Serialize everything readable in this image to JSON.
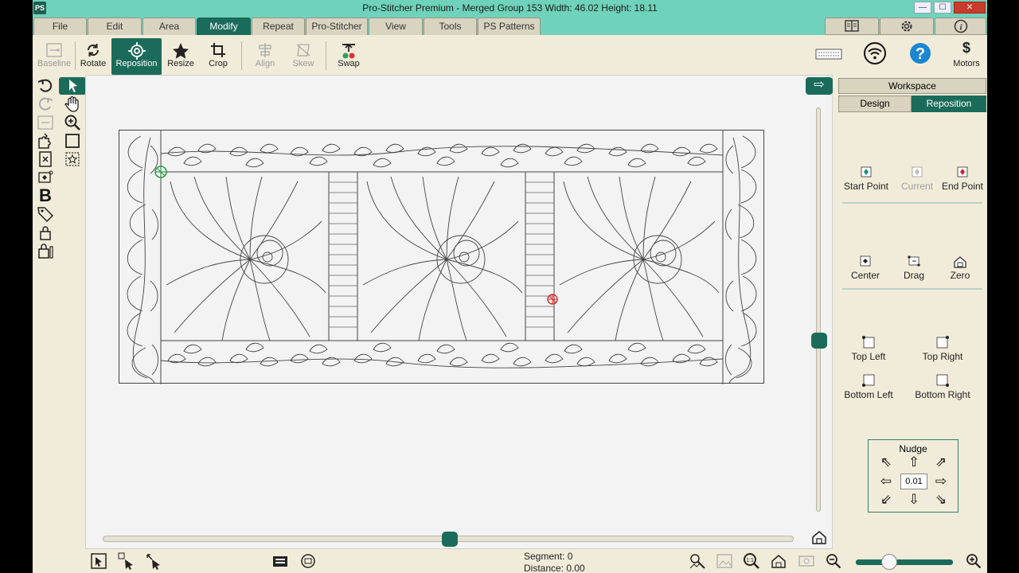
{
  "title_bar": {
    "app_logo": "PS",
    "title": "Pro-Stitcher Premium   -   Merged Group 153   Width: 46.02   Height: 18.11",
    "minimize": "—",
    "maximize": "☐",
    "close": "✕"
  },
  "menu": {
    "tabs": [
      "File",
      "Edit",
      "Area",
      "Modify",
      "Repeat",
      "Pro-Stitcher",
      "View",
      "Tools",
      "PS Patterns"
    ],
    "active_tab": "Modify"
  },
  "toolbar": {
    "baseline": "Baseline",
    "rotate": "Rotate",
    "reposition": "Reposition",
    "resize": "Resize",
    "crop": "Crop",
    "align": "Align",
    "skew": "Skew",
    "swap": "Swap",
    "motors": "Motors"
  },
  "right_panel": {
    "workspace_tab": "Workspace",
    "design_tab": "Design",
    "reposition_tab": "Reposition",
    "start_point": "Start Point",
    "current": "Current",
    "end_point": "End Point",
    "center": "Center",
    "drag": "Drag",
    "zero": "Zero",
    "top_left": "Top Left",
    "top_right": "Top Right",
    "bottom_left": "Bottom Left",
    "bottom_right": "Bottom Right",
    "nudge_title": "Nudge",
    "nudge_value": "0.01"
  },
  "status": {
    "segment": "Segment: 0",
    "distance": "Distance:  0.00"
  },
  "colors": {
    "accent": "#1b6b5a",
    "titlebar": "#6fd2bb",
    "panel_bg": "#f1ecd9"
  }
}
